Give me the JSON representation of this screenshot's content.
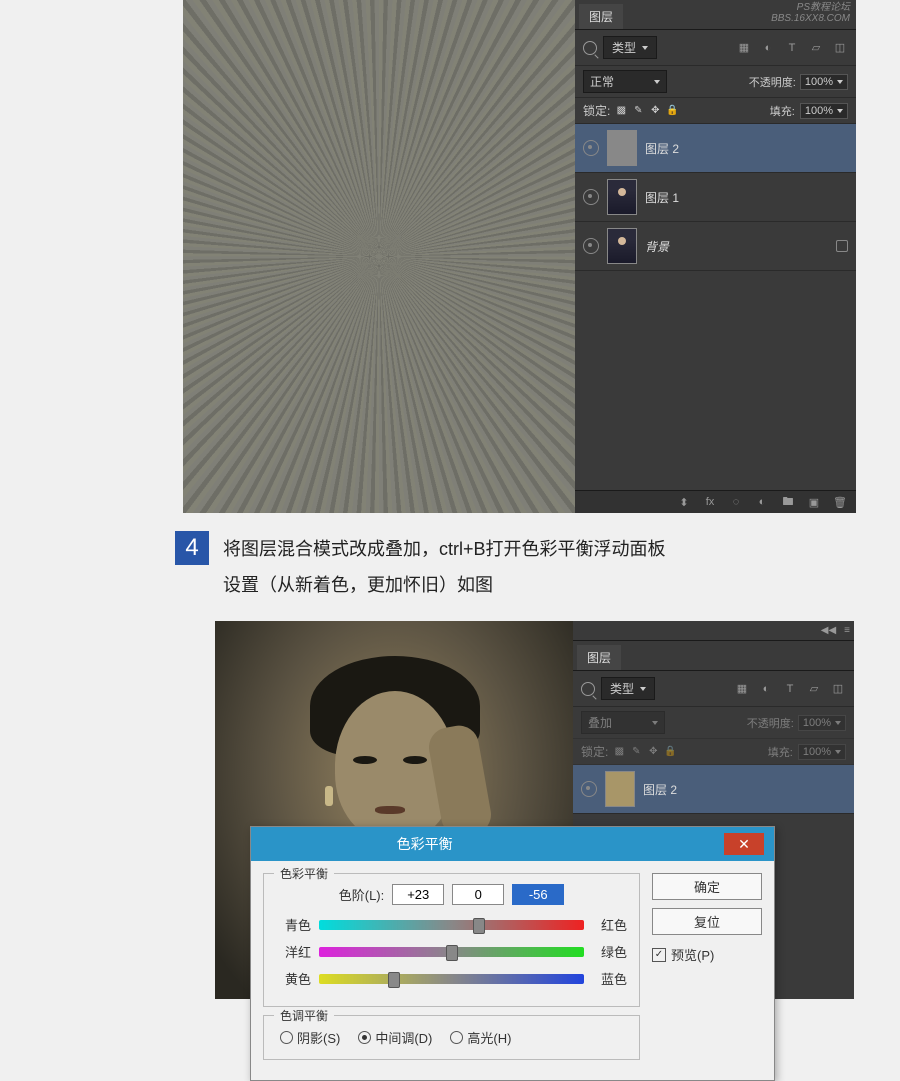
{
  "watermark": {
    "l1": "PS教程论坛",
    "l2": "BBS.16XX8.COM"
  },
  "panel": {
    "tab": "图层",
    "filterType": "类型",
    "blendNormal": "正常",
    "blendOverlay": "叠加",
    "opacityLabel": "不透明度:",
    "opacityVal": "100%",
    "lockLabel": "锁定:",
    "fillLabel": "填充:",
    "fillVal": "100%",
    "layers": [
      {
        "name": "图层 2"
      },
      {
        "name": "图层 1"
      },
      {
        "name": "背景"
      }
    ],
    "fx": "fx"
  },
  "step": {
    "num": "4",
    "line1": "将图层混合模式改成叠加，ctrl+B打开色彩平衡浮动面板",
    "line2": "设置（从新着色，更加怀旧）如图"
  },
  "dialog": {
    "title": "色彩平衡",
    "fs1": "色彩平衡",
    "levelLabel": "色阶(L):",
    "v1": "+23",
    "v2": "0",
    "v3": "-56",
    "cyan": "青色",
    "red": "红色",
    "magenta": "洋红",
    "green": "绿色",
    "yellow": "黄色",
    "blue": "蓝色",
    "fs2": "色调平衡",
    "shadows": "阴影(S)",
    "midtones": "中间调(D)",
    "highlights": "高光(H)",
    "ok": "确定",
    "cancel": "复位",
    "preview": "预览(P)"
  }
}
